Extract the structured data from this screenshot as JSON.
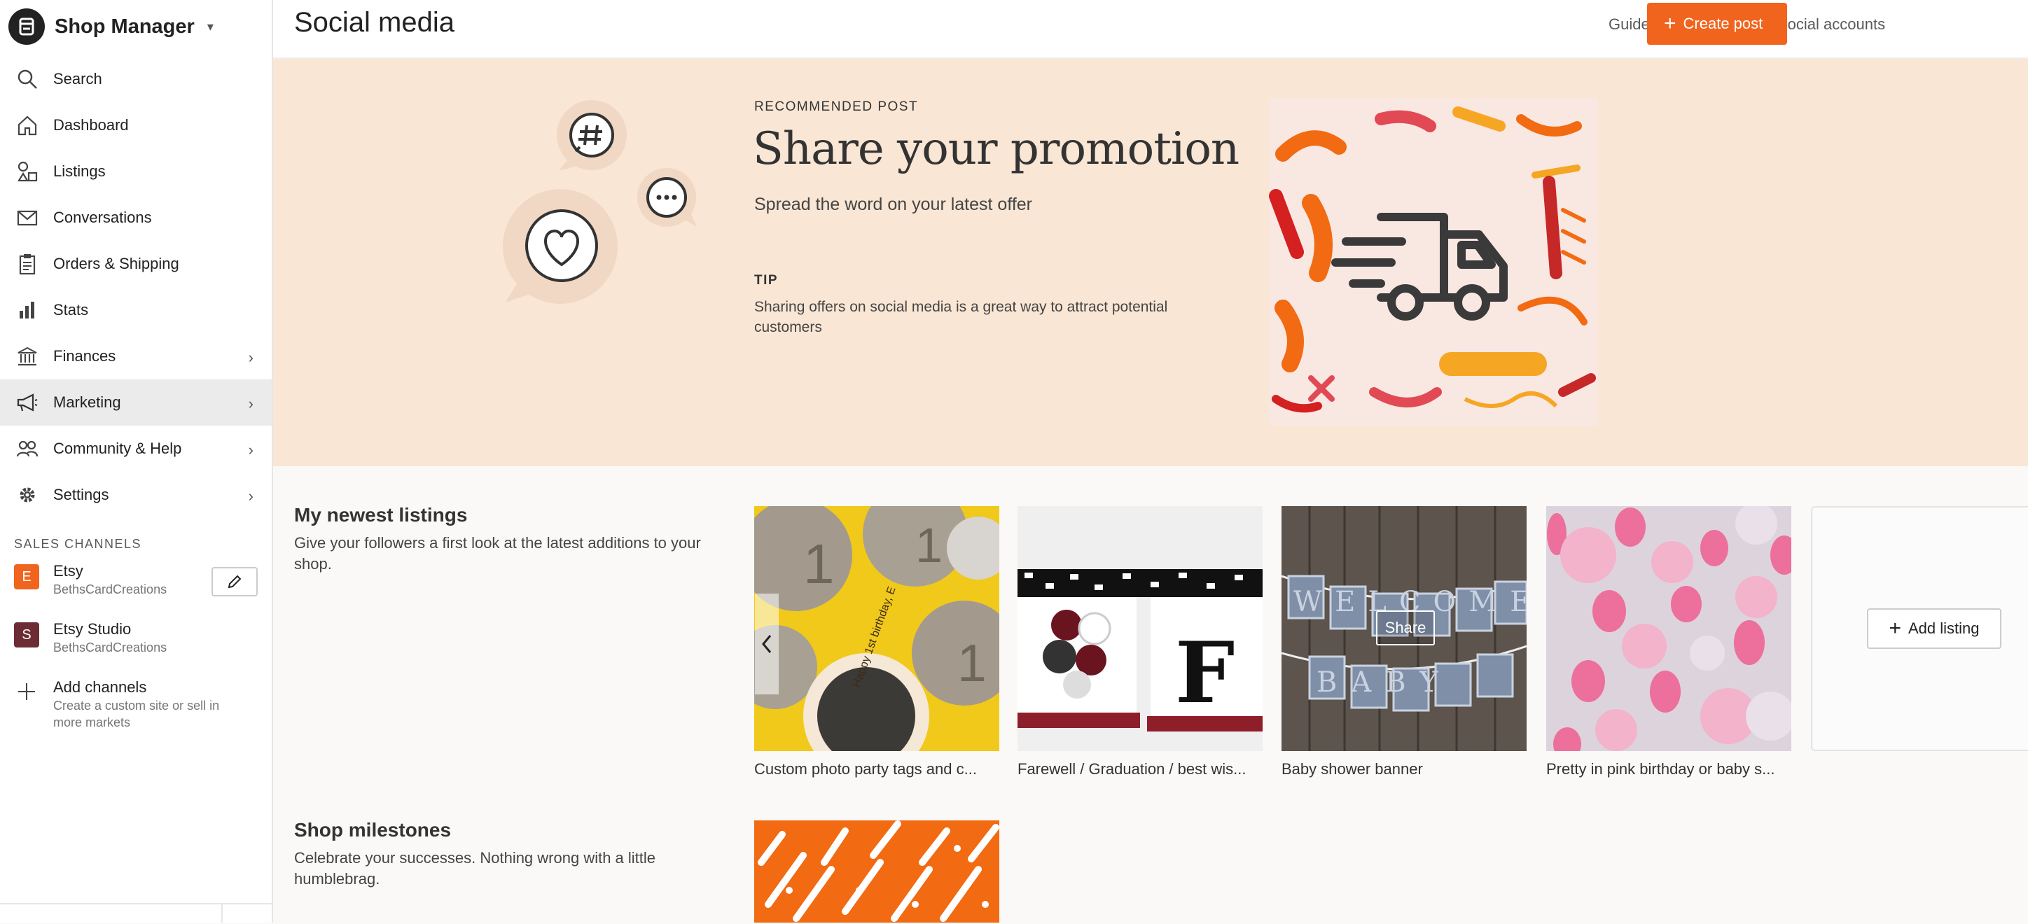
{
  "sidebar": {
    "brand": "Shop Manager",
    "nav": [
      {
        "label": "Search",
        "icon": "search-icon"
      },
      {
        "label": "Dashboard",
        "icon": "home-icon"
      },
      {
        "label": "Listings",
        "icon": "listings-icon"
      },
      {
        "label": "Conversations",
        "icon": "mail-icon"
      },
      {
        "label": "Orders & Shipping",
        "icon": "clipboard-icon"
      },
      {
        "label": "Stats",
        "icon": "bar-chart-icon"
      },
      {
        "label": "Finances",
        "icon": "bank-icon"
      },
      {
        "label": "Marketing",
        "icon": "megaphone-icon"
      },
      {
        "label": "Community & Help",
        "icon": "people-icon"
      },
      {
        "label": "Settings",
        "icon": "gear-icon"
      }
    ],
    "sales_channels_title": "SALES CHANNELS",
    "channels": [
      {
        "badge": "E",
        "name": "Etsy",
        "shop": "BethsCardCreations",
        "color": "#f1641e"
      },
      {
        "badge": "S",
        "name": "Etsy Studio",
        "shop": "BethsCardCreations",
        "color": "#6b2d33"
      }
    ],
    "add_channels": {
      "title": "Add channels",
      "desc": "Create a custom site or sell in more markets"
    }
  },
  "header": {
    "title": "Social media",
    "links": [
      "Guidelines and tips",
      "Social accounts"
    ],
    "create_label": "Create post"
  },
  "hero": {
    "label": "RECOMMENDED POST",
    "title": "Share your promotion",
    "subtitle": "Spread the word on your latest offer",
    "tip_label": "TIP",
    "tip_text": "Sharing offers on social media is a great way to attract potential customers"
  },
  "listings": {
    "title": "My newest listings",
    "desc": "Give your followers a first look at the latest additions to your shop.",
    "items": [
      {
        "caption": "Custom photo party tags and c..."
      },
      {
        "caption": "Farewell / Graduation / best wis..."
      },
      {
        "caption": "Baby shower banner"
      },
      {
        "caption": "Pretty in pink birthday or baby s..."
      }
    ],
    "share_label": "Share",
    "add_label": "Add listing",
    "tag_text": "Happy 1st birthday, E",
    "banner_letter": "F",
    "banner_word1": "WELCOME",
    "banner_word2": "BABY"
  },
  "milestones": {
    "title": "Shop milestones",
    "desc": "Celebrate your successes. Nothing wrong with a little humblebrag."
  },
  "colors": {
    "accent": "#f1641e",
    "hero_bg": "#fae6d4",
    "active_nav": "#ebebeb"
  }
}
